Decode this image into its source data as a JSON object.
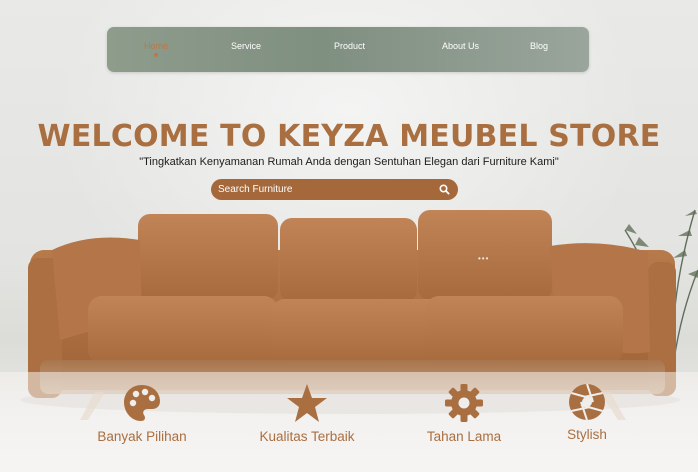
{
  "nav": {
    "items": [
      {
        "label": "Home",
        "active": true
      },
      {
        "label": "Service",
        "active": false
      },
      {
        "label": "Product",
        "active": false
      },
      {
        "label": "About Us",
        "active": false
      },
      {
        "label": "Blog",
        "active": false
      }
    ]
  },
  "hero": {
    "title": "WELCOME TO KEYZA MEUBEL STORE",
    "subtitle": "\"Tingkatkan Kenyamanan Rumah Anda dengan Sentuhan Elegan dari Furniture Kami\""
  },
  "search": {
    "placeholder": "Search Furniture",
    "icon": "search-icon"
  },
  "features": [
    {
      "label": "Banyak Pilihan",
      "icon": "palette-icon"
    },
    {
      "label": "Kualitas Terbaik",
      "icon": "star-icon"
    },
    {
      "label": "Tahan Lama",
      "icon": "gear-icon"
    },
    {
      "label": "Stylish",
      "icon": "aperture-icon"
    }
  ],
  "colors": {
    "accent": "#a96f41",
    "nav_bg": "#8e9c8c",
    "search_bg": "#a4683b",
    "text_dark": "#1c1c1c"
  }
}
